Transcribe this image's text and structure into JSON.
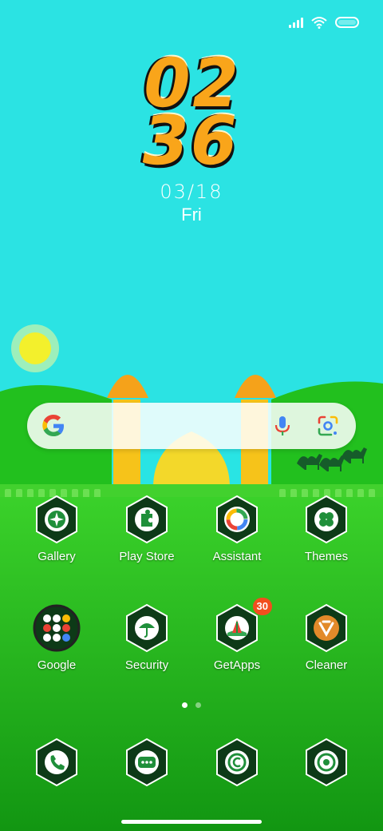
{
  "status_bar": {
    "signal_icon": "signal-bars-icon",
    "wifi_icon": "wifi-icon",
    "battery_icon": "battery-icon"
  },
  "lock_clock": {
    "hours": "02",
    "minutes": "36",
    "date": "03/18",
    "weekday": "Fri"
  },
  "search_widget": {
    "logo_icon": "google-g-icon",
    "voice_icon": "microphone-icon",
    "lens_icon": "google-lens-icon"
  },
  "apps": [
    {
      "label": "Gallery",
      "icon": "gallery-icon"
    },
    {
      "label": "Play Store",
      "icon": "play-store-icon"
    },
    {
      "label": "Assistant",
      "icon": "assistant-icon"
    },
    {
      "label": "Themes",
      "icon": "themes-icon"
    },
    {
      "label": "Google",
      "icon": "google-folder-icon"
    },
    {
      "label": "Security",
      "icon": "security-icon"
    },
    {
      "label": "GetApps",
      "icon": "getapps-icon",
      "badge": "30"
    },
    {
      "label": "Cleaner",
      "icon": "cleaner-icon"
    }
  ],
  "dock": [
    {
      "icon": "phone-icon"
    },
    {
      "icon": "messages-icon"
    },
    {
      "icon": "browser-icon"
    },
    {
      "icon": "camera-icon"
    }
  ],
  "pager": {
    "pages": 2,
    "current": 1
  },
  "colors": {
    "sky": "#2be3e3",
    "grass": "#1faa1f",
    "accent_orange": "#f9a51a",
    "badge": "#f24e1e"
  }
}
